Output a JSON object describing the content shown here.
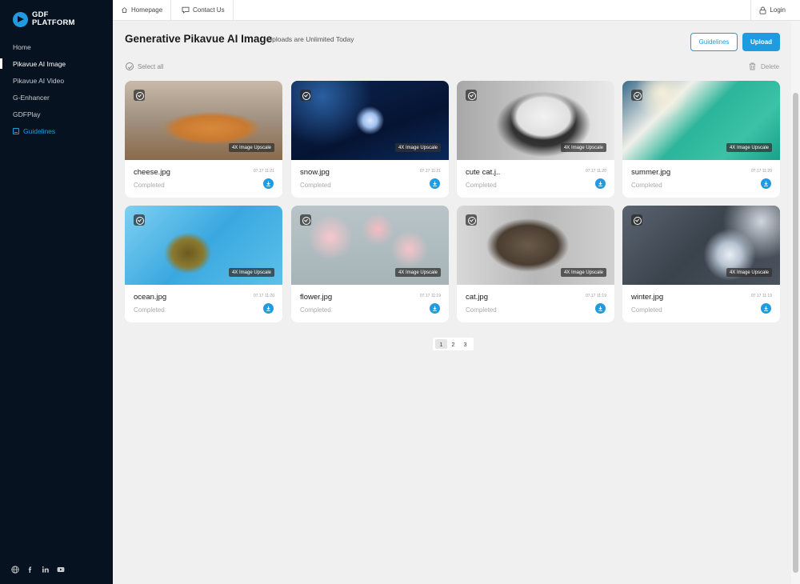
{
  "brand": {
    "line1": "GDF",
    "line2": "PLATFORM",
    "accent": "#1f9be0"
  },
  "sidebar": {
    "items": [
      {
        "label": "Home"
      },
      {
        "label": "Pikavue AI Image"
      },
      {
        "label": "Pikavue AI Video"
      },
      {
        "label": "G-Enhancer"
      },
      {
        "label": "GDFPlay"
      },
      {
        "label": "Guidelines"
      }
    ],
    "social_icons": [
      "globe-icon",
      "facebook-icon",
      "linkedin-icon",
      "youtube-icon"
    ]
  },
  "topbar": {
    "homepage": "Homepage",
    "contact": "Contact Us",
    "login": "Login"
  },
  "header": {
    "title": "Generative Pikavue AI Image",
    "subtitle": "Uploads are Unlimited Today",
    "guidelines_btn": "Guidelines",
    "upload_btn": "Upload"
  },
  "toolbar": {
    "select_all": "Select all",
    "delete": "Delete"
  },
  "cards": [
    {
      "name": "cheese.jpg",
      "date": "07.17 11:21",
      "status": "Completed",
      "badge": "4X Image Upscale"
    },
    {
      "name": "snow.jpg",
      "date": "07.17 11:21",
      "status": "Completed",
      "badge": "4X Image Upscale"
    },
    {
      "name": "cute cat.j..",
      "date": "07.17 11:20",
      "status": "Completed",
      "badge": "4X Image Upscale"
    },
    {
      "name": "summer.jpg",
      "date": "07.17 11:20",
      "status": "Completed",
      "badge": "4X Image Upscale"
    },
    {
      "name": "ocean.jpg",
      "date": "07.17 11:20",
      "status": "Completed",
      "badge": "4X Image Upscale"
    },
    {
      "name": "flower.jpg",
      "date": "07.17 11:19",
      "status": "Completed",
      "badge": "4X Image Upscale"
    },
    {
      "name": "cat.jpg",
      "date": "07.17 11:19",
      "status": "Completed",
      "badge": "4X Image Upscale"
    },
    {
      "name": "winter.jpg",
      "date": "07.17 11:19",
      "status": "Completed",
      "badge": "4X Image Upscale"
    }
  ],
  "pagination": {
    "pages": [
      "1",
      "2",
      "3"
    ],
    "current": "1"
  }
}
